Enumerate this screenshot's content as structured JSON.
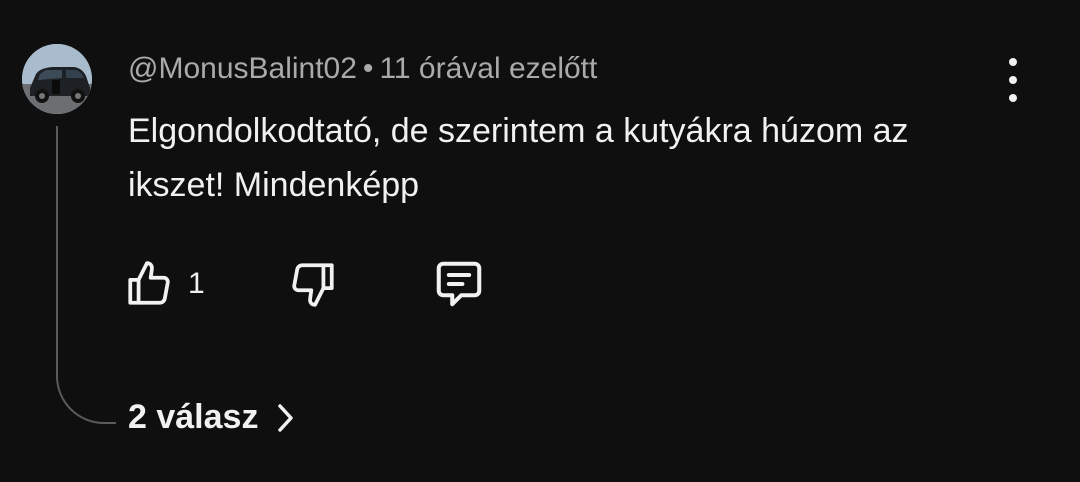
{
  "comment": {
    "author": "@MonusBalint02",
    "separator": "•",
    "time": "11 órával ezelőtt",
    "text": "Elgondolkodtató, de szerintem a kutyákra húzom az ikszet! Mindenképp",
    "like_count": "1",
    "replies_label": "2 válasz"
  },
  "icons": {
    "avatar": "avatar-car-photo",
    "menu": "more-vertical-icon",
    "like": "thumbs-up-icon",
    "dislike": "thumbs-down-icon",
    "reply": "comment-icon",
    "expand": "chevron-right-icon"
  },
  "colors": {
    "background": "#0f0f0f",
    "text_primary": "#f1f1f1",
    "text_secondary": "#aaaaaa",
    "thread_line": "#5a5a5a"
  }
}
